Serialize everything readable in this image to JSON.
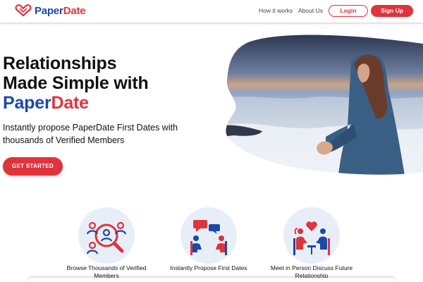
{
  "header": {
    "logo_part1": "Paper",
    "logo_part2": "Date",
    "nav": [
      "How it works",
      "About Us"
    ],
    "login_label": "Login",
    "signup_label": "Sign Up"
  },
  "hero": {
    "title_line1": "Relationships",
    "title_line2": "Made Simple with",
    "title_brand1": "Paper",
    "title_brand2": "Date",
    "subtitle": "Instantly propose PaperDate First Dates with thousands of Verified Members",
    "cta_label": "GET STARTED"
  },
  "features": [
    {
      "label": "Browse Thousands of Verified Members",
      "icon": "people-search-icon"
    },
    {
      "label": "Instantly Propose First Dates",
      "icon": "conversation-icon"
    },
    {
      "label": "Meet in Person Discuss Future Relationship",
      "icon": "couple-date-icon"
    }
  ],
  "colors": {
    "brand_blue": "#1a49a8",
    "brand_red": "#e0333b"
  }
}
